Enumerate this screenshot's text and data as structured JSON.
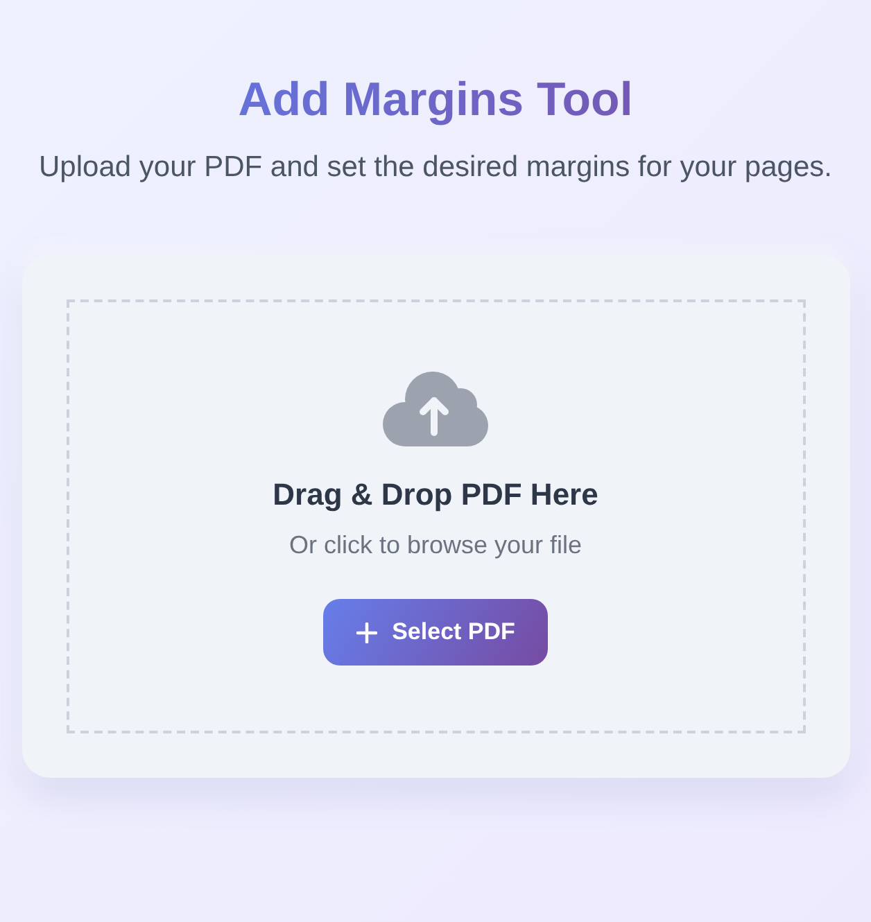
{
  "header": {
    "title": "Add Margins Tool",
    "subtitle": "Upload your PDF and set the desired margins for your pages."
  },
  "upload_zone": {
    "heading": "Drag & Drop PDF Here",
    "hint": "Or click to browse your file",
    "button": {
      "label": "Select PDF"
    }
  }
}
